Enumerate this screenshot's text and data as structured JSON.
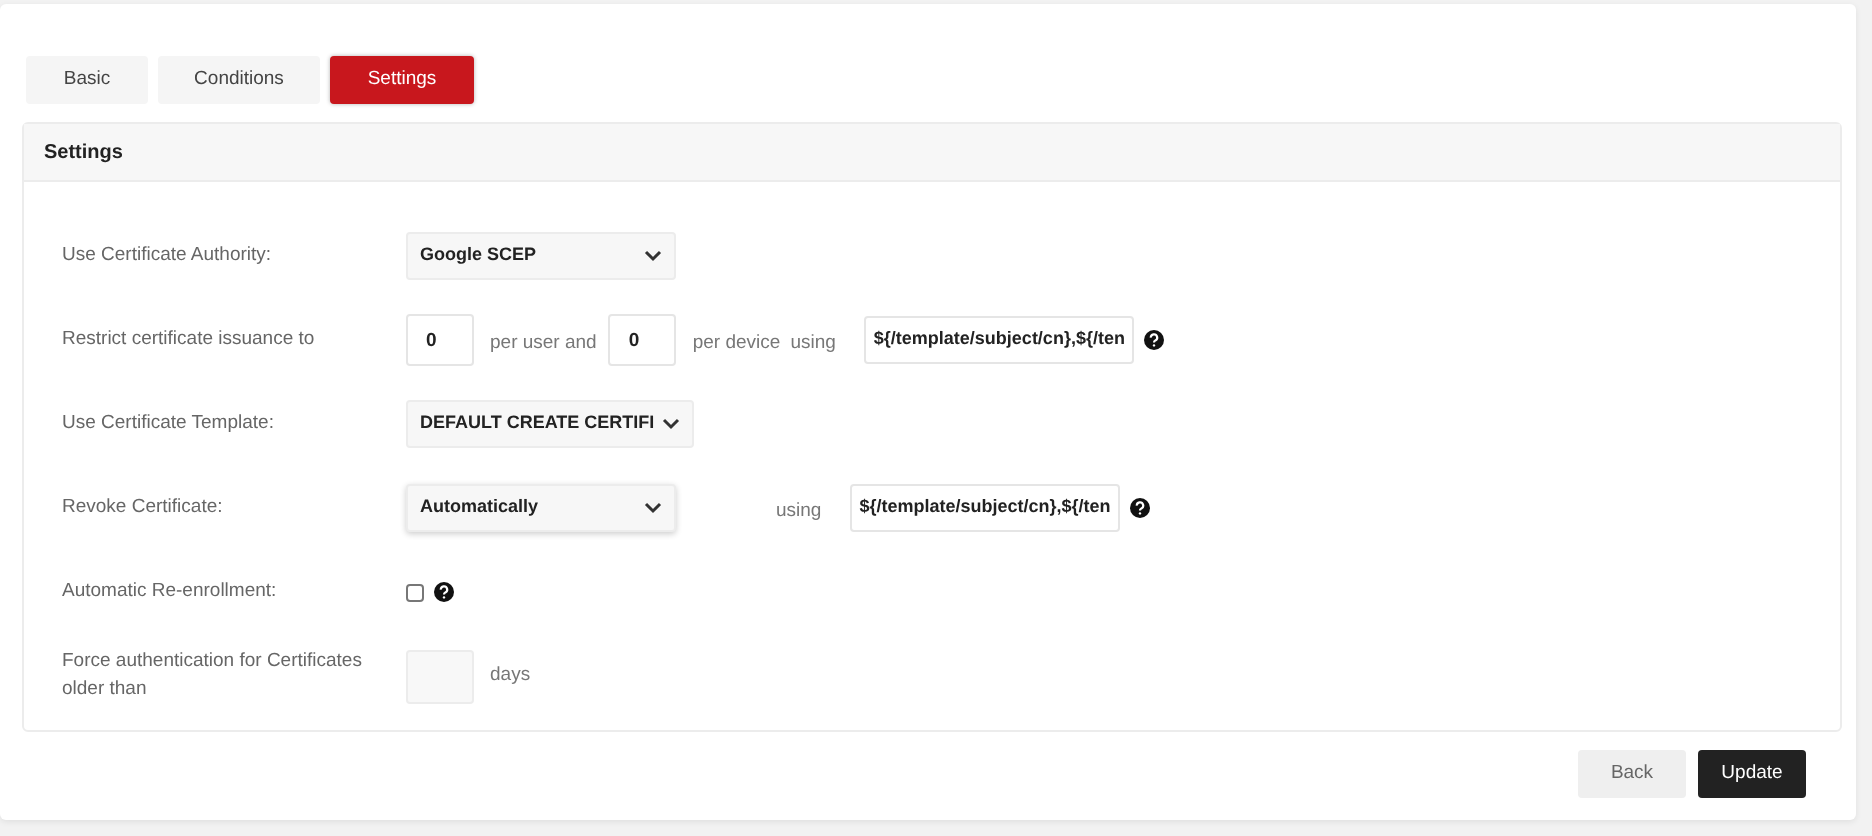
{
  "tabs": [
    {
      "label": "Basic",
      "selected": false
    },
    {
      "label": "Conditions",
      "selected": false
    },
    {
      "label": "Settings",
      "selected": true
    }
  ],
  "panel": {
    "title": "Settings"
  },
  "rows": [
    {
      "kind": "select",
      "label": "Use Certificate Authority:",
      "value": "Google SCEP"
    },
    {
      "kind": "restrict",
      "label": "Restrict certificate issuance to",
      "per_user": "0",
      "per_user_text": "per user and",
      "per_device": "0",
      "per_device_text": "per device",
      "using_text": "using",
      "expression": "${/template/subject/cn},${/ten"
    },
    {
      "kind": "select",
      "label": "Use Certificate Template:",
      "value": "DEFAULT CREATE CERTIFI"
    },
    {
      "kind": "revoke",
      "label": "Revoke Certificate:",
      "value": "Automatically",
      "using_text": "using",
      "expression": "${/template/subject/cn},${/ten"
    },
    {
      "kind": "checkbox",
      "label": "Automatic Re-enrollment:",
      "checked": false
    },
    {
      "kind": "days",
      "label": "Force authentication for Certificates older than",
      "unit": "days"
    }
  ],
  "buttons": [
    {
      "label": "Back",
      "kind": "secondary"
    },
    {
      "label": "Update",
      "kind": "primary"
    }
  ]
}
